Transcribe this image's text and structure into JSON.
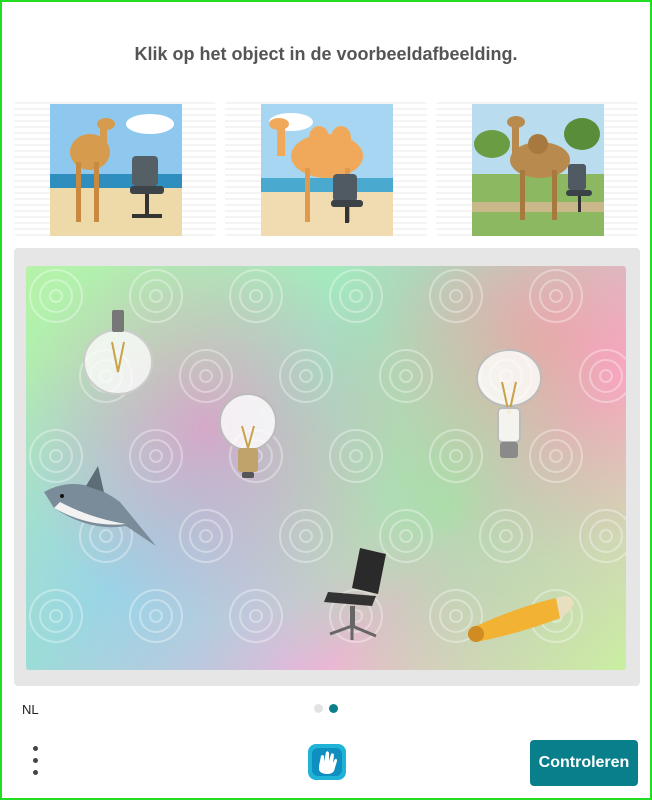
{
  "prompt": "Klik op het object in de voorbeeldafbeelding.",
  "examples": [
    {
      "name": "camel-with-office-chair-beach-1",
      "icon": "camel-chair-image"
    },
    {
      "name": "camel-with-office-chair-beach-2",
      "icon": "camel-chair-image"
    },
    {
      "name": "camel-with-office-chair-park",
      "icon": "camel-chair-image"
    }
  ],
  "challenge_objects": [
    {
      "icon": "lightbulb-icon"
    },
    {
      "icon": "lightbulb-icon"
    },
    {
      "icon": "lightbulb-icon"
    },
    {
      "icon": "shark-icon"
    },
    {
      "icon": "office-chair-icon"
    },
    {
      "icon": "corn-icon"
    }
  ],
  "footer": {
    "language": "NL",
    "pagination": {
      "current": 2,
      "total": 2
    },
    "verify_label": "Controleren"
  },
  "colors": {
    "accent": "#0a7f8c",
    "border": "#22dd22",
    "prompt_text": "#555555",
    "dot_inactive": "#e3e3e3",
    "dot_active": "#0a7f8c"
  }
}
